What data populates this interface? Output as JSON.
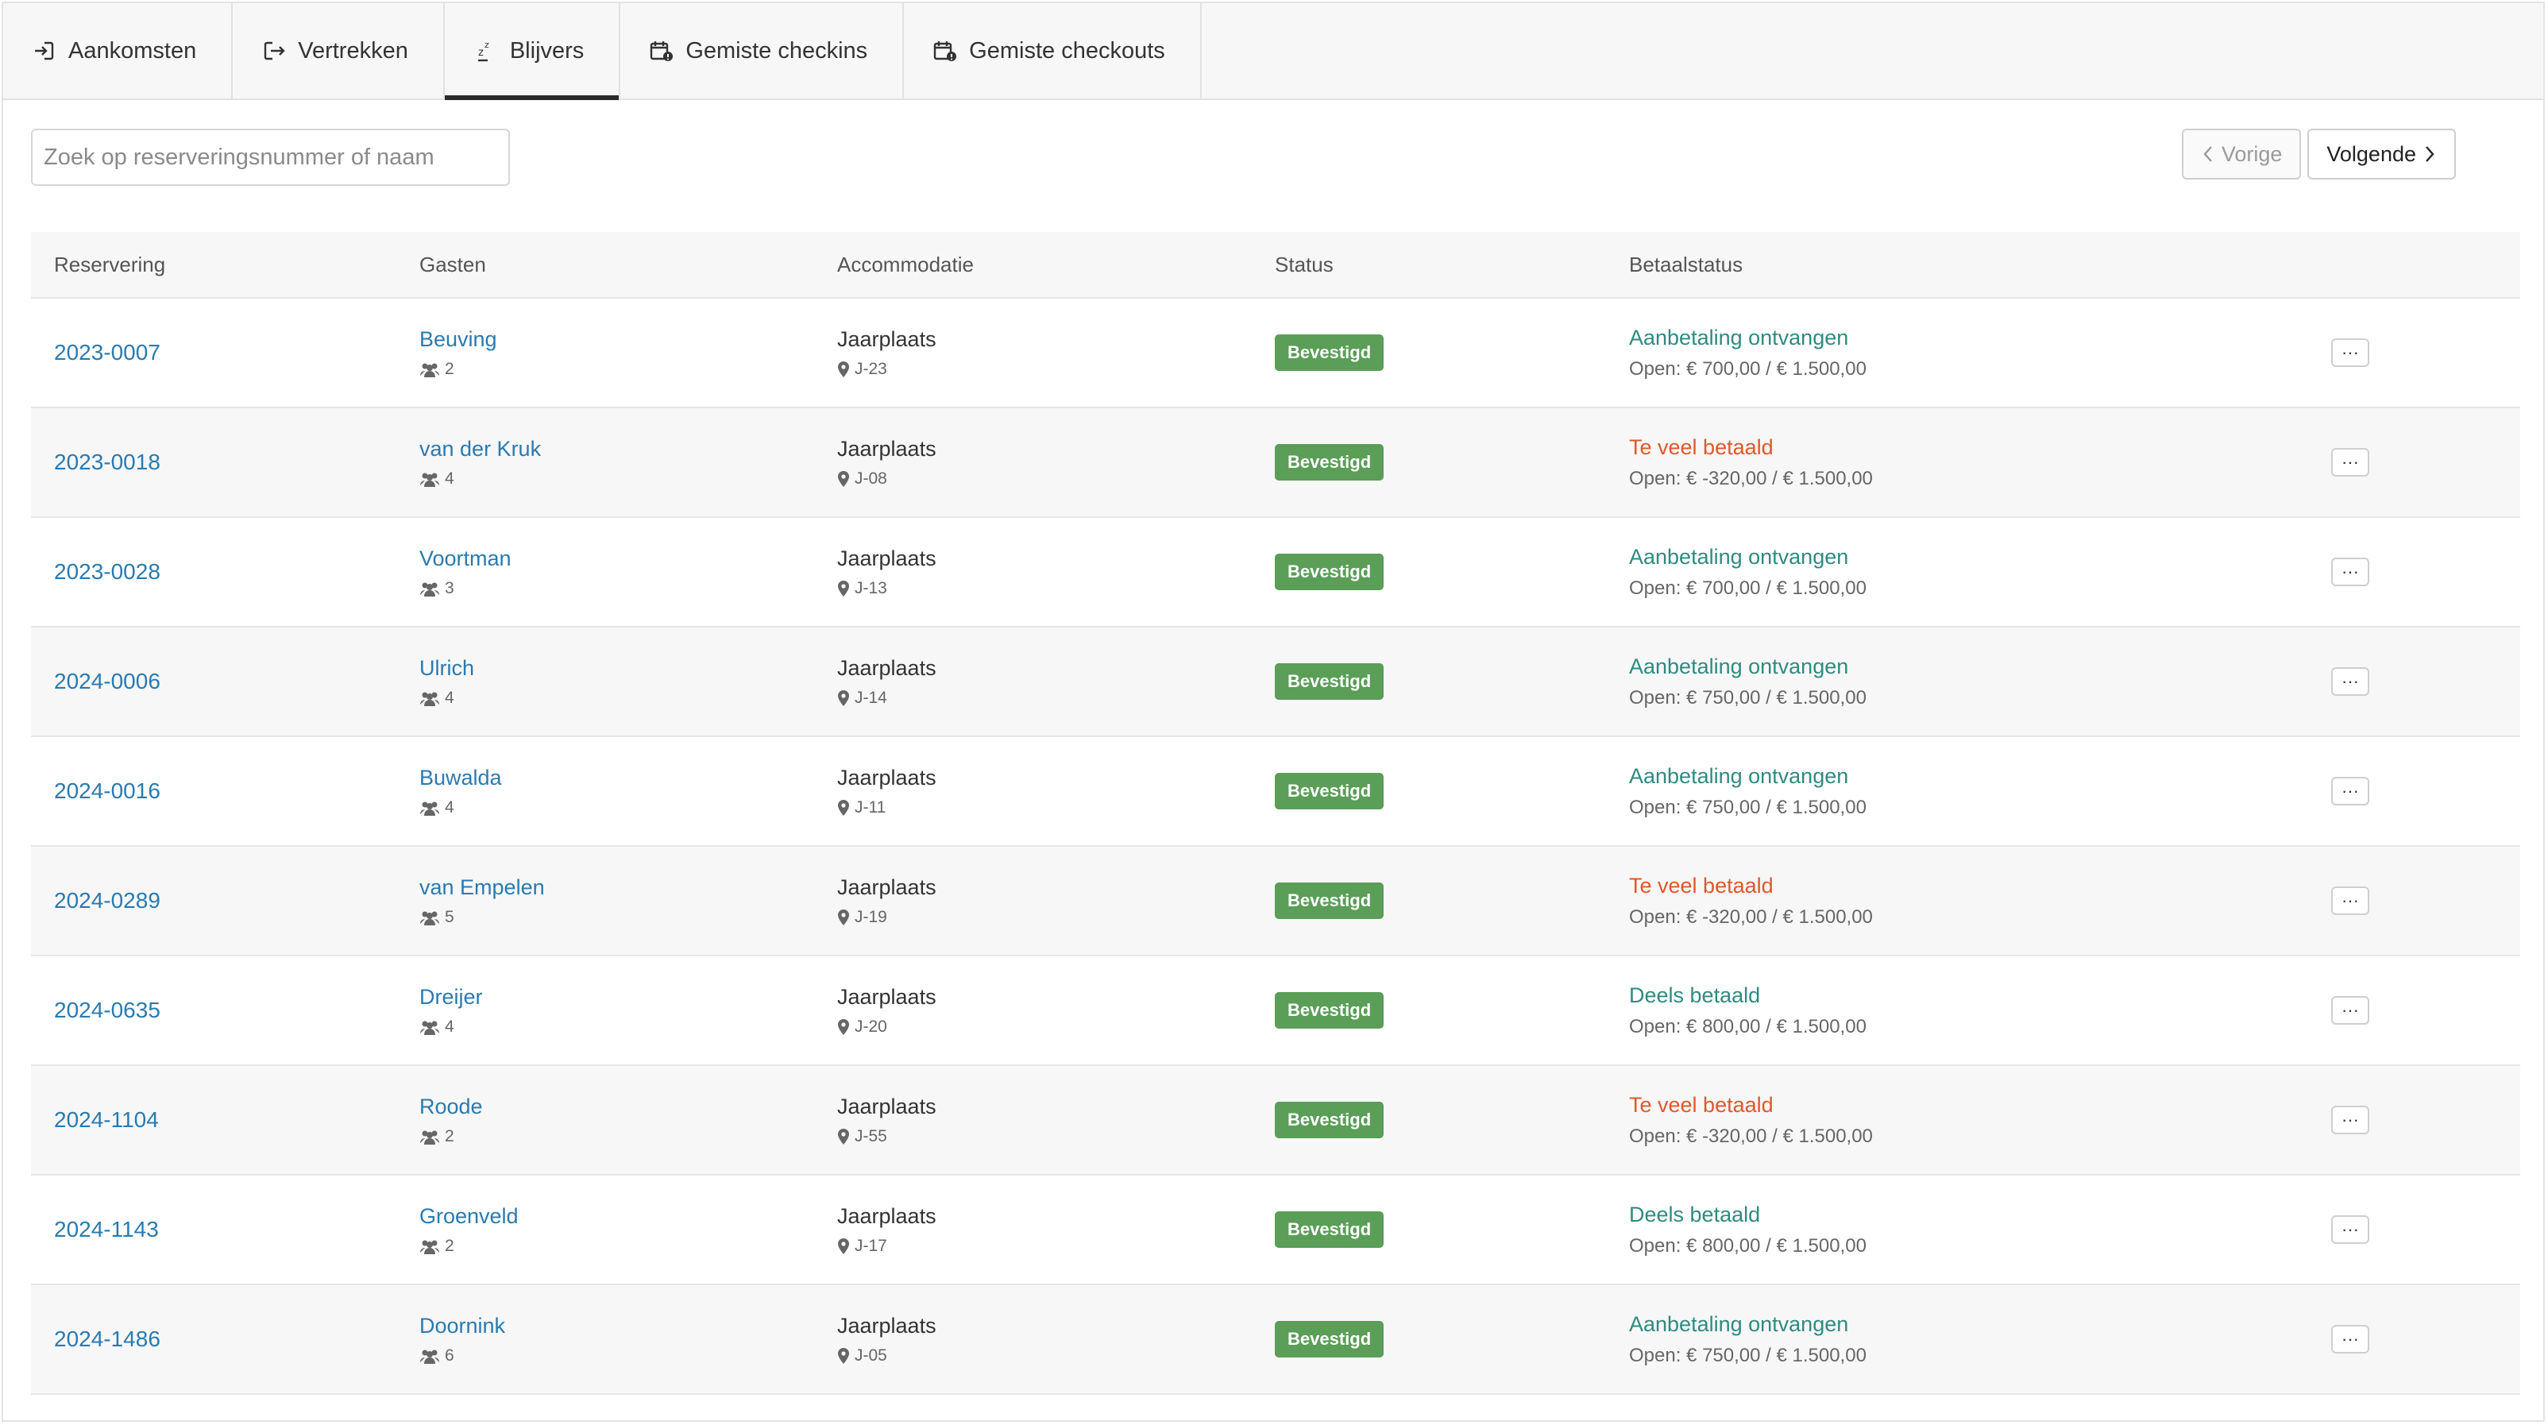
{
  "tabs": [
    {
      "label": "Aankomsten",
      "icon": "sign-in-icon",
      "active": false
    },
    {
      "label": "Vertrekken",
      "icon": "sign-out-icon",
      "active": false
    },
    {
      "label": "Blijvers",
      "icon": "sleep-icon",
      "active": true
    },
    {
      "label": "Gemiste checkins",
      "icon": "calendar-alert-icon",
      "active": false
    },
    {
      "label": "Gemiste checkouts",
      "icon": "calendar-alert-icon",
      "active": false
    }
  ],
  "search": {
    "placeholder": "Zoek op reserveringsnummer of naam",
    "value": ""
  },
  "pager": {
    "prev_label": "Vorige",
    "next_label": "Volgende"
  },
  "table": {
    "headers": [
      "Reservering",
      "Gasten",
      "Accommodatie",
      "Status",
      "Betaalstatus"
    ],
    "rows": [
      {
        "res": "2023-0007",
        "guest": "Beuving",
        "count": "2",
        "acc": "Jaarplaats",
        "spot": "J-23",
        "status": "Bevestigd",
        "pay": "Aanbetaling ontvangen",
        "pay_type": "ok",
        "open": "Open: € 700,00 / € 1.500,00"
      },
      {
        "res": "2023-0018",
        "guest": "van der Kruk",
        "count": "4",
        "acc": "Jaarplaats",
        "spot": "J-08",
        "status": "Bevestigd",
        "pay": "Te veel betaald",
        "pay_type": "over",
        "open": "Open: € -320,00 / € 1.500,00"
      },
      {
        "res": "2023-0028",
        "guest": "Voortman",
        "count": "3",
        "acc": "Jaarplaats",
        "spot": "J-13",
        "status": "Bevestigd",
        "pay": "Aanbetaling ontvangen",
        "pay_type": "ok",
        "open": "Open: € 700,00 / € 1.500,00"
      },
      {
        "res": "2024-0006",
        "guest": "Ulrich",
        "count": "4",
        "acc": "Jaarplaats",
        "spot": "J-14",
        "status": "Bevestigd",
        "pay": "Aanbetaling ontvangen",
        "pay_type": "ok",
        "open": "Open: € 750,00 / € 1.500,00"
      },
      {
        "res": "2024-0016",
        "guest": "Buwalda",
        "count": "4",
        "acc": "Jaarplaats",
        "spot": "J-11",
        "status": "Bevestigd",
        "pay": "Aanbetaling ontvangen",
        "pay_type": "ok",
        "open": "Open: € 750,00 / € 1.500,00"
      },
      {
        "res": "2024-0289",
        "guest": "van Empelen",
        "count": "5",
        "acc": "Jaarplaats",
        "spot": "J-19",
        "status": "Bevestigd",
        "pay": "Te veel betaald",
        "pay_type": "over",
        "open": "Open: € -320,00 / € 1.500,00"
      },
      {
        "res": "2024-0635",
        "guest": "Dreijer",
        "count": "4",
        "acc": "Jaarplaats",
        "spot": "J-20",
        "status": "Bevestigd",
        "pay": "Deels betaald",
        "pay_type": "ok",
        "open": "Open: € 800,00 / € 1.500,00"
      },
      {
        "res": "2024-1104",
        "guest": "Roode",
        "count": "2",
        "acc": "Jaarplaats",
        "spot": "J-55",
        "status": "Bevestigd",
        "pay": "Te veel betaald",
        "pay_type": "over",
        "open": "Open: € -320,00 / € 1.500,00"
      },
      {
        "res": "2024-1143",
        "guest": "Groenveld",
        "count": "2",
        "acc": "Jaarplaats",
        "spot": "J-17",
        "status": "Bevestigd",
        "pay": "Deels betaald",
        "pay_type": "ok",
        "open": "Open: € 800,00 / € 1.500,00"
      },
      {
        "res": "2024-1486",
        "guest": "Doornink",
        "count": "6",
        "acc": "Jaarplaats",
        "spot": "J-05",
        "status": "Bevestigd",
        "pay": "Aanbetaling ontvangen",
        "pay_type": "ok",
        "open": "Open: € 750,00 / € 1.500,00"
      }
    ],
    "more_label": "···"
  },
  "colors": {
    "link": "#2a7ab0",
    "badge": "#5a9e57",
    "pay_ok": "#2e8b80",
    "pay_over": "#e0572b"
  }
}
